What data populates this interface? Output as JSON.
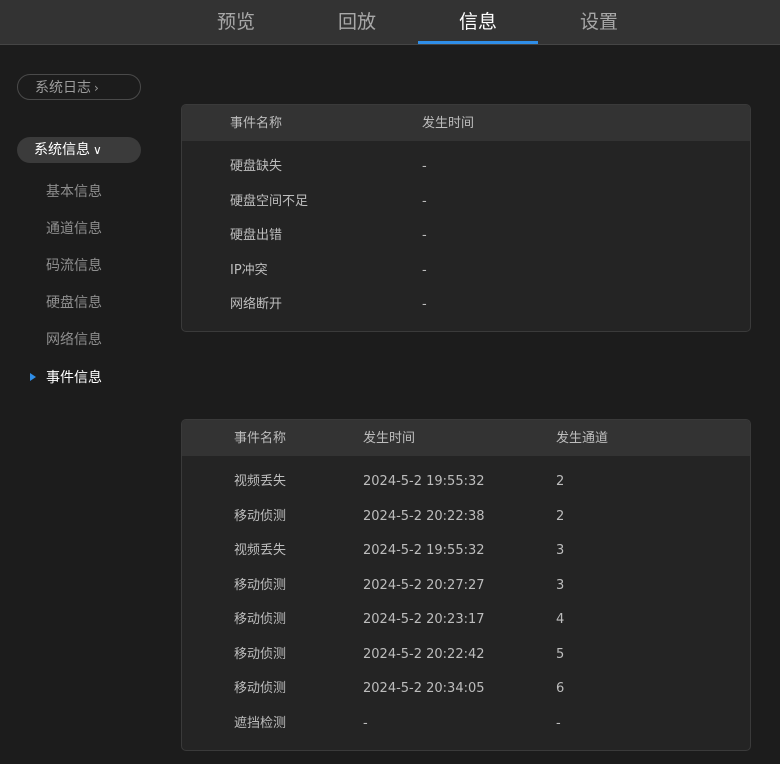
{
  "nav": {
    "tabs": [
      {
        "label": "预览"
      },
      {
        "label": "回放"
      },
      {
        "label": "信息"
      },
      {
        "label": "设置"
      }
    ],
    "active_tab": "信息",
    "accent_color": "#2f8ee8"
  },
  "sidebar": {
    "log_label": "系统日志",
    "log_icon": "chevron-right-icon",
    "sys_label": "系统信息",
    "sys_icon": "chevron-down-icon",
    "items": [
      {
        "label": "基本信息"
      },
      {
        "label": "通道信息"
      },
      {
        "label": "码流信息"
      },
      {
        "label": "硬盘信息"
      },
      {
        "label": "网络信息"
      },
      {
        "label": "事件信息"
      }
    ],
    "active_item": "事件信息"
  },
  "table1": {
    "headers": [
      "事件名称",
      "发生时间"
    ],
    "rows": [
      [
        "硬盘缺失",
        "-"
      ],
      [
        "硬盘空间不足",
        "-"
      ],
      [
        "硬盘出错",
        "-"
      ],
      [
        "IP冲突",
        "-"
      ],
      [
        "网络断开",
        "-"
      ]
    ]
  },
  "table2": {
    "headers": [
      "事件名称",
      "发生时间",
      "发生通道"
    ],
    "rows": [
      [
        "视频丢失",
        "2024-5-2 19:55:32",
        "2"
      ],
      [
        "移动侦测",
        "2024-5-2 20:22:38",
        "2"
      ],
      [
        "视频丢失",
        "2024-5-2 19:55:32",
        "3"
      ],
      [
        "移动侦测",
        "2024-5-2 20:27:27",
        "3"
      ],
      [
        "移动侦测",
        "2024-5-2 20:23:17",
        "4"
      ],
      [
        "移动侦测",
        "2024-5-2 20:22:42",
        "5"
      ],
      [
        "移动侦测",
        "2024-5-2 20:34:05",
        "6"
      ],
      [
        "遮挡检测",
        "-",
        "-"
      ]
    ]
  }
}
